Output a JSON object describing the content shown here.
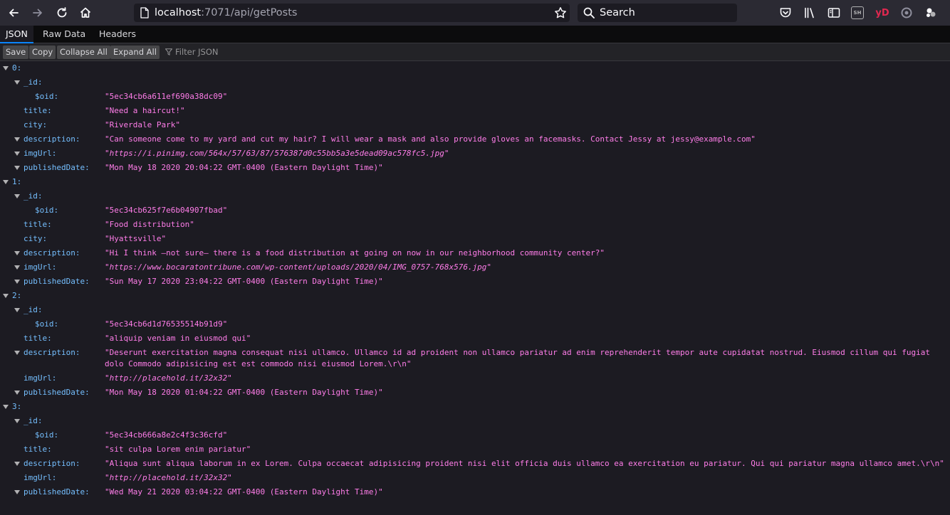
{
  "browser": {
    "url_host": "localhost",
    "url_path": ":7071/api/getPosts",
    "search_placeholder": "Search",
    "ext_sh_label": "SH",
    "ext_yd_label": "yD"
  },
  "viewer": {
    "tabs": [
      "JSON",
      "Raw Data",
      "Headers"
    ],
    "toolbar": {
      "save": "Save",
      "copy": "Copy",
      "collapse_all": "Collapse All",
      "expand_all": "Expand All",
      "filter_placeholder": "Filter JSON"
    }
  },
  "posts": [
    {
      "index": "0:",
      "id_key": "_id:",
      "oid_key": "$oid:",
      "oid": "\"5ec34cb6a611ef690a38dc09\"",
      "title_key": "title:",
      "title": "\"Need a haircut!\"",
      "city_key": "city:",
      "city": "\"Riverdale Park\"",
      "description_key": "description:",
      "description": "\"Can someone come to my yard and cut my hair?  I will wear a mask and also provide gloves an facemasks.  Contact Jessy at jessy@example.com\"",
      "imgUrl_key": "imgUrl:",
      "imgUrl": "\"https://i.pinimg.com/564x/57/63/87/576387d0c55bb5a3e5dead09ac578fc5.jpg\"",
      "publishedDate_key": "publishedDate:",
      "publishedDate": "\"Mon May 18 2020 20:04:22 GMT-0400 (Eastern Daylight Time)\""
    },
    {
      "index": "1:",
      "id_key": "_id:",
      "oid_key": "$oid:",
      "oid": "\"5ec34cb625f7e6b04907fbad\"",
      "title_key": "title:",
      "title": "\"Food distribution\"",
      "city_key": "city:",
      "city": "\"Hyattsville\"",
      "description_key": "description:",
      "description": "\"Hi I think —not sure— there is a food distribution at going on now in our neighborhood community center?\"",
      "imgUrl_key": "imgUrl:",
      "imgUrl": "\"https://www.bocaratontribune.com/wp-content/uploads/2020/04/IMG_0757-768x576.jpg\"",
      "publishedDate_key": "publishedDate:",
      "publishedDate": "\"Sun May 17 2020 23:04:22 GMT-0400 (Eastern Daylight Time)\""
    },
    {
      "index": "2:",
      "id_key": "_id:",
      "oid_key": "$oid:",
      "oid": "\"5ec34cb6d1d76535514b91d9\"",
      "title_key": "title:",
      "title": "\"aliquip veniam in eiusmod qui\"",
      "description_key": "description:",
      "description": "\"Deserunt exercitation magna consequat nisi ullamco. Ullamco id ad proident non ullamco pariatur ad enim reprehenderit tempor aute cupidatat nostrud. Eiusmod cillum qui fugiat dolo Commodo adipisicing est est commodo nisi eiusmod Lorem.\\r\\n\"",
      "imgUrl_key": "imgUrl:",
      "imgUrl": "\"http://placehold.it/32x32\"",
      "publishedDate_key": "publishedDate:",
      "publishedDate": "\"Mon May 18 2020 01:04:22 GMT-0400 (Eastern Daylight Time)\""
    },
    {
      "index": "3:",
      "id_key": "_id:",
      "oid_key": "$oid:",
      "oid": "\"5ec34cb666a8e2c4f3c36cfd\"",
      "title_key": "title:",
      "title": "\"sit culpa Lorem enim pariatur\"",
      "description_key": "description:",
      "description": "\"Aliqua sunt aliqua laborum in ex Lorem. Culpa occaecat adipisicing proident nisi elit officia duis ullamco ea exercitation eu pariatur. Qui qui pariatur magna ullamco amet.\\r\\n\"",
      "imgUrl_key": "imgUrl:",
      "imgUrl": "\"http://placehold.it/32x32\"",
      "publishedDate_key": "publishedDate:",
      "publishedDate": "\"Wed May 21 2020 03:04:22 GMT-0400 (Eastern Daylight Time)\""
    }
  ]
}
